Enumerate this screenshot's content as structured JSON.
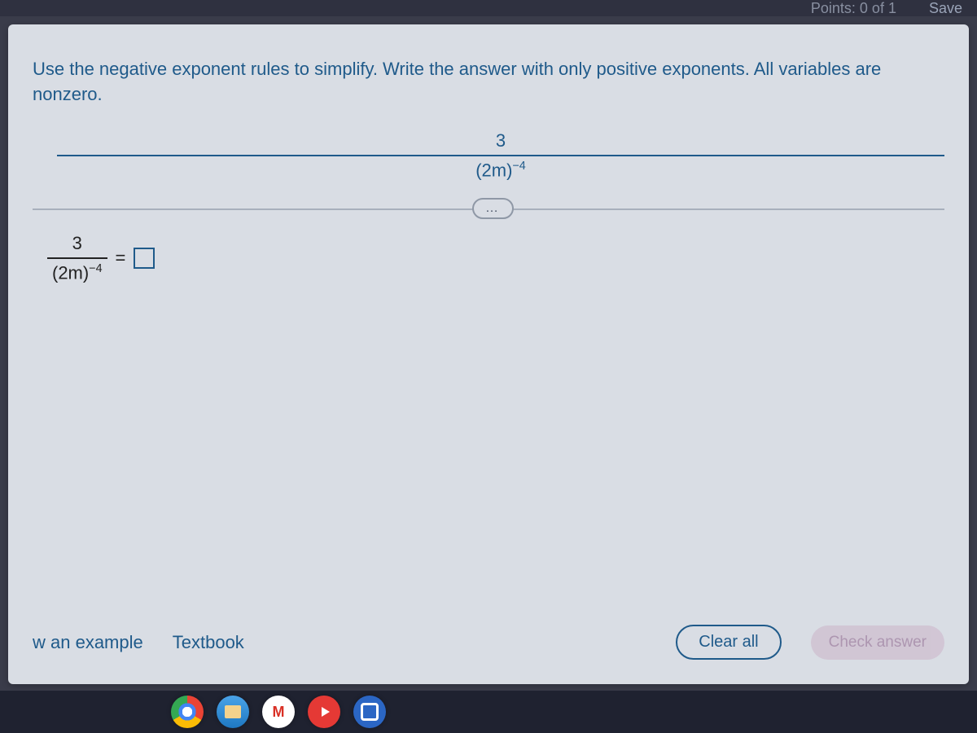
{
  "topbar": {
    "points_label": "Points: 0 of 1",
    "save_label": "Save"
  },
  "instruction": "Use the negative exponent rules to simplify. Write the answer with only positive exponents. All variables are nonzero.",
  "problem": {
    "numerator": "3",
    "denom_base": "(2m)",
    "denom_exp": "−4"
  },
  "divider": {
    "ellipsis": "…"
  },
  "answer_line": {
    "numerator": "3",
    "denom_base": "(2m)",
    "denom_exp": "−4",
    "equals": "="
  },
  "buttons": {
    "view_example": "w an example",
    "textbook": "Textbook",
    "clear_all": "Clear all",
    "check_answer": "Check answer"
  }
}
